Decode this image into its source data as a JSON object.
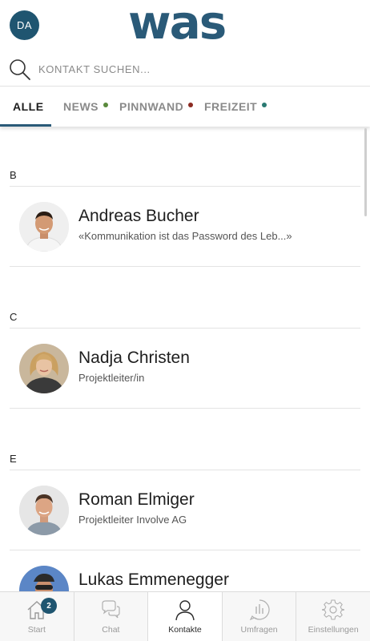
{
  "header": {
    "avatar_initials": "DA",
    "logo_text": "was"
  },
  "search": {
    "placeholder": "KONTAKT SUCHEN..."
  },
  "tabs": [
    {
      "label": "ALLE",
      "active": true,
      "dot_color": null
    },
    {
      "label": "NEWS",
      "active": false,
      "dot_color": "#5a8a3c"
    },
    {
      "label": "PINNWAND",
      "active": false,
      "dot_color": "#8c2b22"
    },
    {
      "label": "FREIZEIT",
      "active": false,
      "dot_color": "#2a7a72"
    }
  ],
  "sections": [
    {
      "letter": "B",
      "contacts": [
        {
          "name": "Andreas Bucher",
          "subtitle": "«Kommunikation ist das Password des Leb...»"
        }
      ]
    },
    {
      "letter": "C",
      "contacts": [
        {
          "name": "Nadja Christen",
          "subtitle": "Projektleiter/in"
        }
      ]
    },
    {
      "letter": "E",
      "contacts": [
        {
          "name": "Roman Elmiger",
          "subtitle": "Projektleiter Involve AG"
        },
        {
          "name": "Lukas Emmenegger",
          "subtitle": ""
        }
      ]
    }
  ],
  "bottom_nav": [
    {
      "label": "Start",
      "icon": "home-icon",
      "badge": "2",
      "active": false
    },
    {
      "label": "Chat",
      "icon": "chat-icon",
      "badge": null,
      "active": false
    },
    {
      "label": "Kontakte",
      "icon": "person-icon",
      "badge": null,
      "active": true
    },
    {
      "label": "Umfragen",
      "icon": "poll-icon",
      "badge": null,
      "active": false
    },
    {
      "label": "Einstellungen",
      "icon": "gear-icon",
      "badge": null,
      "active": false
    }
  ],
  "colors": {
    "brand": "#2a5a78",
    "badge": "#1f5570"
  }
}
